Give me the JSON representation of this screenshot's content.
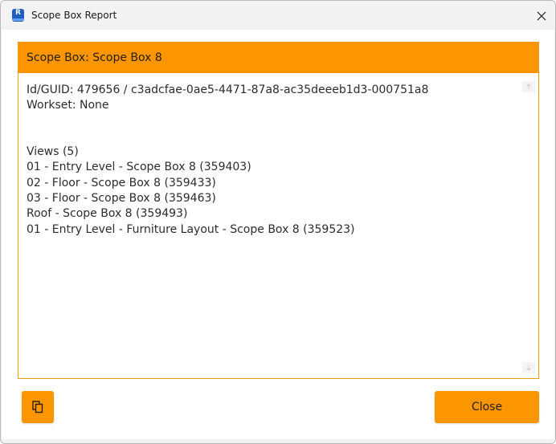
{
  "window": {
    "title": "Scope Box Report",
    "app_icon_letter": "R"
  },
  "panel": {
    "header": "Scope Box: Scope Box 8",
    "lines": {
      "id_guid": "Id/GUID: 479656 / c3adcfae-0ae5-4471-87a8-ac35deeeb1d3-000751a8",
      "workset": "Workset: None",
      "views_heading": "Views (5)",
      "views": [
        "01 - Entry Level - Scope Box 8 (359403)",
        "02 - Floor - Scope Box 8 (359433)",
        "03 - Floor - Scope Box 8 (359463)",
        "Roof - Scope Box 8 (359493)",
        "01 - Entry Level - Furniture Layout - Scope Box 8 (359523)"
      ]
    }
  },
  "footer": {
    "close_label": "Close",
    "copy_icon": "copy-icon"
  },
  "colors": {
    "accent": "#fb9600",
    "panel_border": "#f39a12"
  }
}
